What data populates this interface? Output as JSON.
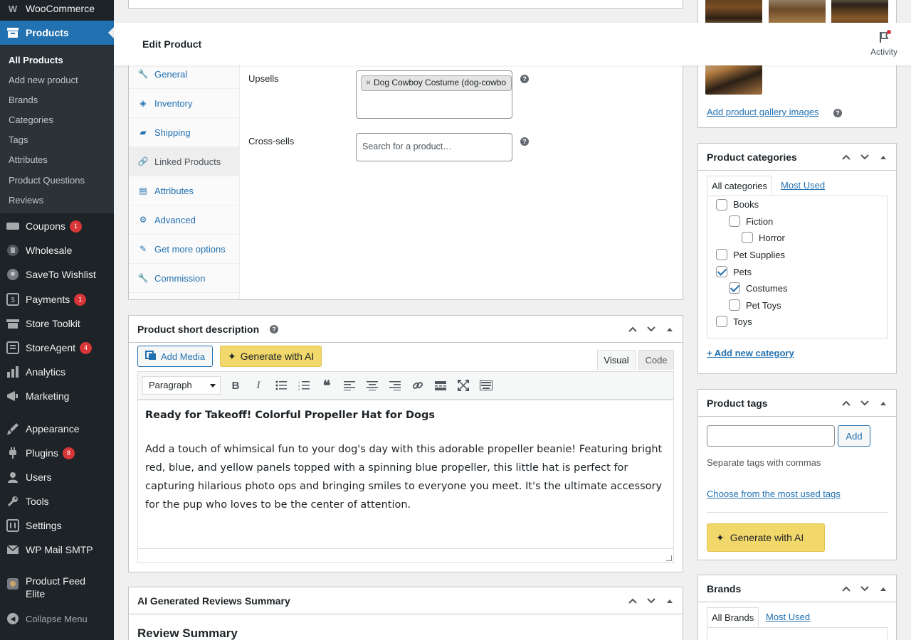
{
  "sidebar": {
    "woocommerce": "WooCommerce",
    "products": "Products",
    "sub": [
      "All Products",
      "Add new product",
      "Brands",
      "Categories",
      "Tags",
      "Attributes",
      "Product Questions",
      "Reviews"
    ],
    "coupons": "Coupons",
    "coupons_badge": "1",
    "wholesale": "Wholesale",
    "saveto": "SaveTo Wishlist",
    "payments": "Payments",
    "payments_badge": "1",
    "store_toolkit": "Store Toolkit",
    "storeagent": "StoreAgent",
    "storeagent_badge": "4",
    "analytics": "Analytics",
    "marketing": "Marketing",
    "appearance": "Appearance",
    "plugins": "Plugins",
    "plugins_badge": "8",
    "users": "Users",
    "tools": "Tools",
    "settings": "Settings",
    "wp_mail": "WP Mail SMTP",
    "product_feed": "Product Feed Elite",
    "collapse": "Collapse Menu"
  },
  "header": {
    "title": "Edit Product",
    "activity": "Activity"
  },
  "product_data": {
    "tabs": [
      "General",
      "Inventory",
      "Shipping",
      "Linked Products",
      "Attributes",
      "Advanced",
      "Get more options",
      "Commission"
    ],
    "upsells_label": "Upsells",
    "upsell_chip": "Dog Cowboy Costume (dog-cowbo",
    "crosssells_label": "Cross-sells",
    "crosssells_placeholder": "Search for a product…"
  },
  "short_desc": {
    "title": "Product short description",
    "add_media": "Add Media",
    "generate_ai": "Generate with AI",
    "tab_visual": "Visual",
    "tab_code": "Code",
    "format": "Paragraph",
    "heading": "Ready for Takeoff! Colorful Propeller Hat for Dogs",
    "body": "Add a touch of whimsical fun to your dog's day with this adorable propeller beanie! Featuring bright red, blue, and yellow panels topped with a spinning blue propeller, this little hat is perfect for capturing hilarious photo ops and bringing smiles to everyone you meet. It's the ultimate accessory for the pup who loves to be the center of attention."
  },
  "reviews_summary": {
    "title": "AI Generated Reviews Summary",
    "subtitle": "Review Summary"
  },
  "gallery": {
    "add_link": "Add product gallery images"
  },
  "categories": {
    "title": "Product categories",
    "tab_all": "All categories",
    "tab_used": "Most Used",
    "items": [
      "Books",
      "Fiction",
      "Horror",
      "Pet Supplies",
      "Pets",
      "Costumes",
      "Pet Toys",
      "Toys"
    ],
    "checked": [
      false,
      false,
      false,
      false,
      true,
      true,
      false,
      false
    ],
    "add_new": "+ Add new category"
  },
  "tags": {
    "title": "Product tags",
    "add_btn": "Add",
    "hint": "Separate tags with commas",
    "choose": "Choose from the most used tags",
    "generate_ai": "Generate with AI"
  },
  "brands": {
    "title": "Brands",
    "tab_all": "All Brands",
    "tab_used": "Most Used"
  }
}
